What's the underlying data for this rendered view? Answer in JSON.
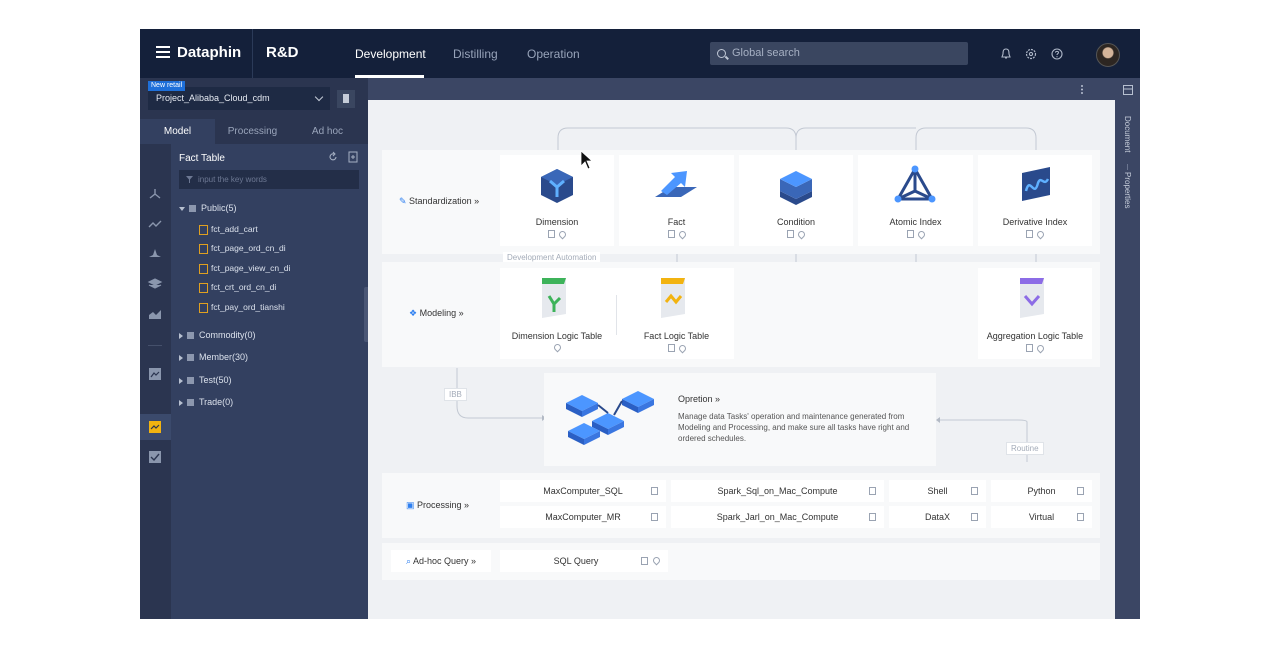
{
  "header": {
    "brand": "Dataphin",
    "module": "R&D",
    "tabs": [
      {
        "label": "Development",
        "active": true
      },
      {
        "label": "Distilling",
        "active": false
      },
      {
        "label": "Operation",
        "active": false
      }
    ],
    "search_placeholder": "Global search"
  },
  "project": {
    "badge": "New retail",
    "name": "Project_Alibaba_Cloud_cdm"
  },
  "sidebar": {
    "tabs": [
      "Model",
      "Processing",
      "Ad hoc"
    ],
    "panel_title": "Fact Table",
    "filter_placeholder": "input the key words",
    "tree": [
      {
        "label": "Public(5)",
        "expanded": true,
        "children": [
          "fct_add_cart",
          "fct_page_ord_cn_di",
          "fct_page_view_cn_di",
          "fct_crt_ord_cn_di",
          "fct_pay_ord_tianshi"
        ]
      },
      {
        "label": "Commodity(0)",
        "expanded": false
      },
      {
        "label": "Member(30)",
        "expanded": false
      },
      {
        "label": "Test(50)",
        "expanded": false
      },
      {
        "label": "Trade(0)",
        "expanded": false
      }
    ]
  },
  "right_panel": {
    "document": "Document",
    "properties": "Properties"
  },
  "flow": {
    "standardization": {
      "label": "Standardization",
      "cards": [
        "Dimension",
        "Fact",
        "Condition",
        "Atomic Index",
        "Derivative Index"
      ]
    },
    "dev_automation_tag": "Development Automation",
    "modeling": {
      "label": "Modeling",
      "cards": [
        "Dimension Logic Table",
        "Fact Logic Table",
        "Aggregation Logic Table"
      ]
    },
    "ibb_tag": "IBB",
    "routine_tag": "Routine",
    "operation": {
      "title": "Opretion",
      "desc": "Manage data Tasks' operation and maintenance generated from Modeling and Processing, and make sure all tasks have right and ordered schedules."
    },
    "processing": {
      "label": "Processing",
      "cells": [
        "MaxComputer_SQL",
        "Spark_Sql_on_Mac_Compute",
        "Shell",
        "Python",
        "MaxComputer_MR",
        "Spark_Jarl_on_Mac_Compute",
        "DataX",
        "Virtual"
      ]
    },
    "adhoc": {
      "label": "Ad-hoc Query",
      "cell": "SQL Query"
    }
  },
  "colors": {
    "topbar": "#14203a",
    "sidebar": "#334060",
    "accent_blue": "#2d7ff0",
    "canvas": "#eff1f4"
  }
}
